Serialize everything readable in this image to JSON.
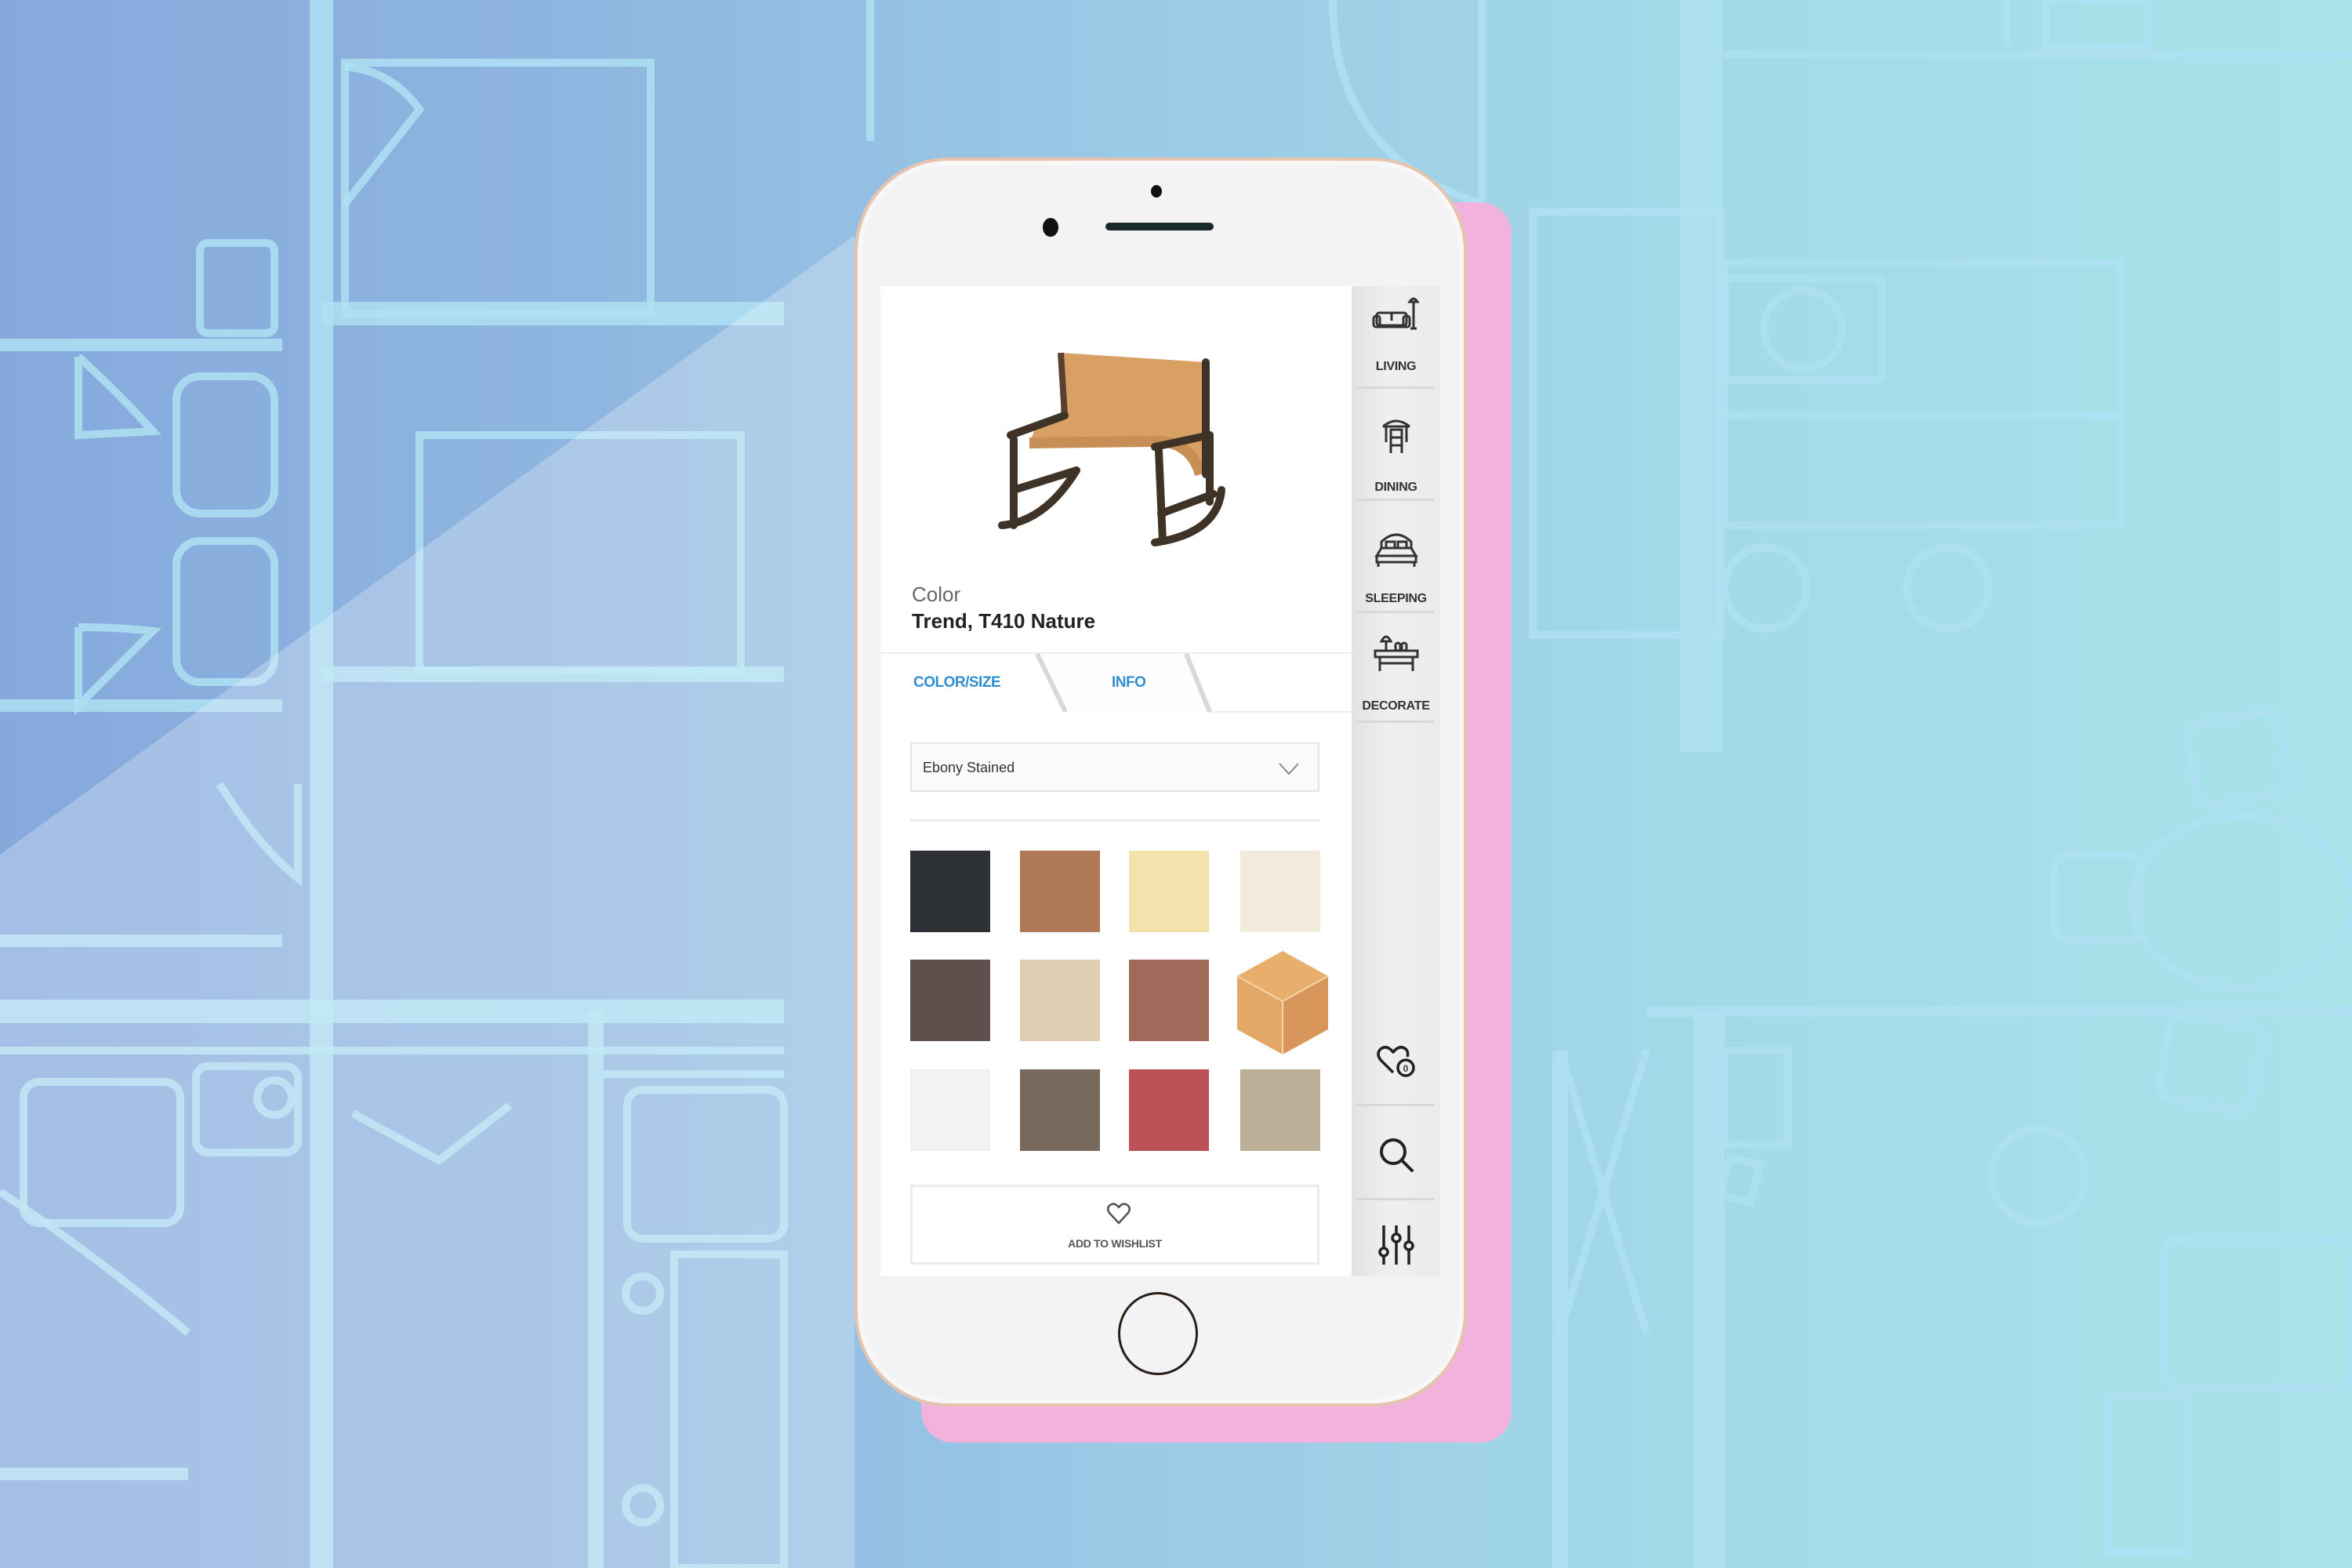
{
  "app": {
    "product": {
      "image_alt": "Rocking chair with tan leather sling seat and dark wood frame",
      "color_label": "Color",
      "color_value": "Trend, T410 Nature"
    },
    "tabs": [
      {
        "label": "COLOR/SIZE",
        "active": true
      },
      {
        "label": "INFO",
        "active": false
      }
    ],
    "frame_select": {
      "value": "Ebony Stained"
    },
    "swatches": [
      {
        "color": "#2e3236",
        "type": "square"
      },
      {
        "color": "#b07a58",
        "type": "square"
      },
      {
        "color": "#f5e1ac",
        "type": "square"
      },
      {
        "color": "#f2eadb",
        "type": "square"
      },
      {
        "color": "#5f4f4d",
        "type": "square"
      },
      {
        "color": "#e0cfb4",
        "type": "square"
      },
      {
        "color": "#a0695a",
        "type": "square"
      },
      {
        "color": "#e3a867",
        "type": "cube"
      },
      {
        "color": "#f3f3f2",
        "type": "square"
      },
      {
        "color": "#79695c",
        "type": "square"
      },
      {
        "color": "#bc5256",
        "type": "square"
      },
      {
        "color": "#bdae97",
        "type": "square"
      }
    ],
    "wishlist_button": {
      "label": "ADD TO WISHLIST",
      "icon": "heart-outline-icon"
    },
    "sidebar": {
      "categories": [
        {
          "label": "LIVING",
          "icon": "sofa-lamp-icon"
        },
        {
          "label": "DINING",
          "icon": "dining-chair-table-icon"
        },
        {
          "label": "SLEEPING",
          "icon": "bed-icon"
        },
        {
          "label": "DECORATE",
          "icon": "console-table-decor-icon"
        }
      ],
      "tools": [
        {
          "name": "wishlist",
          "icon": "heart-badge-icon",
          "badge": "0"
        },
        {
          "name": "search",
          "icon": "search-icon"
        },
        {
          "name": "filter",
          "icon": "sliders-icon"
        }
      ]
    }
  },
  "colors": {
    "accent_tab": "#2f8fcf",
    "pink_backdrop": "#f2b2de",
    "phone_bezel": "#f3f3f5",
    "phone_trim": "#e6c3ad"
  }
}
